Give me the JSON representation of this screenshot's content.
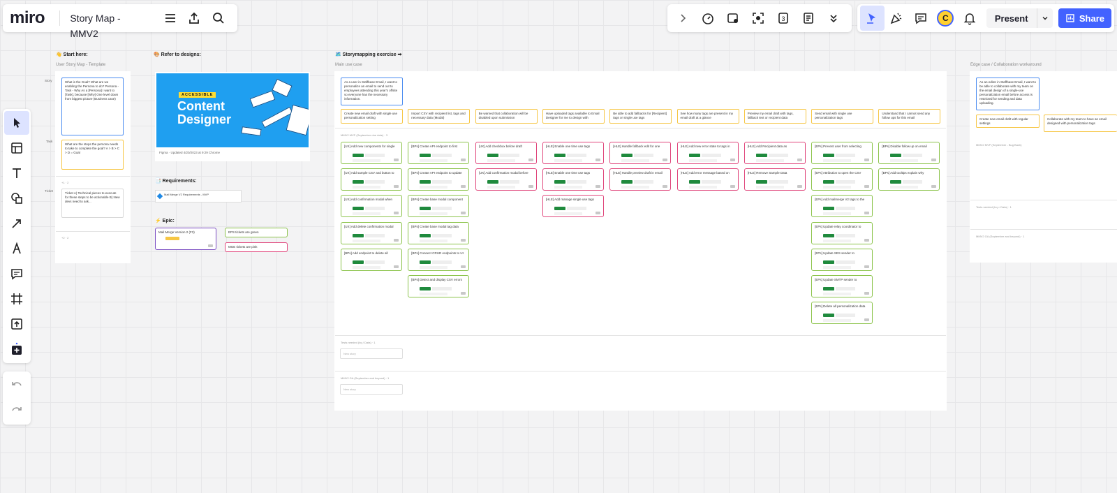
{
  "app": {
    "logo": "miro",
    "board_title": "Story Map - MMV2"
  },
  "toolbar_right": {
    "present_label": "Present",
    "share_label": "Share",
    "avatar_initial": "C",
    "colors": {
      "share_bg": "#4262ff",
      "active_tool_bg": "#dde3ff"
    }
  },
  "left_toolbar": {
    "tools": [
      "select",
      "templates",
      "text",
      "shapes",
      "connection-line",
      "pen",
      "comment",
      "frame",
      "upload",
      "more-apps"
    ]
  },
  "canvas": {
    "sections": {
      "start": {
        "title": "👋 Start here:",
        "label": "User Story Map - Template"
      },
      "designs": {
        "title": "🎨 Refer to designs:"
      },
      "storymap": {
        "title": "🗺️ Storymapping exercise ➡",
        "label": "Main use case"
      },
      "edge": {
        "label": "Edge case / Collaboration workaround"
      },
      "requirements": {
        "title": "📑 Requirements:",
        "item": "Mail Merge V2 Requirements - MVP"
      },
      "epic": {
        "title": "⚡ Epic:",
        "card": "Mail Merge Version 2 (F3)",
        "legend_green": "EPS tickets are green",
        "legend_pink": "MGE tickets are pink"
      }
    },
    "template_rows": {
      "story": "Story",
      "task": "Task",
      "ticket": "Ticket"
    },
    "template_stickies": {
      "goal": "What is the Goal? What are we enabling the Persona to do? Persona - Task - Why As a [Persona] I want to [Task], because [Why] One level down from biggest picture (Business case)",
      "steps": "What are the steps the persona needs to take to complete the goal? A > B > C > D = Goal",
      "ticket": "Ticket A) Technical pieces to execute for these steps to be actionable B) New devs need to ask..."
    },
    "design_image": {
      "badge": "ACCESSIBLE",
      "title": "Content Designer",
      "caption": "Figma · Updated 4/20/2023 at 9:29 Chrome"
    },
    "main": {
      "story": "As a user in Staffbase Email, I want to personalize an email to send out to employees attending this year's offsite so everyone has the necessary information.",
      "tasks": [
        "Create new email draft with single use personalization setting",
        "Import CSV with recipient list, tags and necessary data (Modal)",
        "Be warned that collaboration will be disabled upon submission",
        "Have uploaded tags available to Email Designer for me to design with",
        "Be able to add fallbacks for [Recipient] tags or single use tags",
        "See how many tags are present in my email draft at a glance",
        "Preview my email draft with tags, fallback text or recipient data",
        "Send email with single use personalization tags",
        "Understand that I cannot send any follow ups for this email"
      ],
      "release1_label": "MMV2 MVP (September due date) · 3",
      "columns": [
        [
          "[UX] Add new components for single",
          "[UX] Add sample CSV and button to",
          "[UX] Add confirmation modal when",
          "[UX] Add delete confirmation modal",
          "[BPs] Add endpoint to delete all"
        ],
        [
          "[BPs] Create API endpoint to first",
          "[BPs] Create API endpoint to update",
          "[BPs] Create base modal component",
          "[BPs] Create base modal tag data",
          "[BPs] Connect CRUD endpoints to UI",
          "[BPs] Detect and display CSV errors"
        ],
        [
          "[UX] Add checkbox before draft",
          "[UX] Add confirmation modal before"
        ],
        [
          "[HLE] Enable one time use tags",
          "[HLE] Enable one time use tags",
          "[HLE] Add manage single use tags"
        ],
        [
          "[HLE] Handle fallback edit for one",
          "[HLE] Handle preview draft in email"
        ],
        [
          "[HLE] Add new error state to tags in",
          "[HLE] Add error message based on"
        ],
        [
          "[HLE] Add Recipient data as",
          "[HLE] Remove Sample Data"
        ],
        [
          "[EPs] Prevent user from selecting",
          "[EPs] Attribution to open the CSV",
          "[EPs] Add mailmerge V2 tags to the",
          "[EPs] Update relay coordinator to",
          "[EPs] Update SES sender to",
          "[EPs] Update SMTP sender to",
          "[EPs] Delete all personalization data"
        ],
        [
          "[BPs] Disable follow up on email",
          "[BPs] Add tooltips explain why"
        ]
      ],
      "column_colors": [
        "green",
        "green",
        "pink",
        "pink",
        "pink",
        "pink",
        "pink",
        "green",
        "green"
      ],
      "release2_label": "Tests needed (bq / Data) · 1",
      "release3_label": "MMV2 GA (September and beyond) · 1",
      "new_story": "New story"
    },
    "edge": {
      "story": "As an editor in Staffbase Email, I want to be able to collaborate with my team on the email design of a single-use personalization email before access is restricted for sending and data uploading.",
      "task1": "Create new email draft with regular settings",
      "task2": "Collaborate with my team to have an email designed with personalization tags",
      "rel1": "MMV2 MVP (September - Bug Bash)",
      "rel2": "Tests needed (bq > Data) · 1",
      "rel3": "MMV2 GA (September and beyond) · 1"
    },
    "tiny_counts": {
      "t1": "+1 · 2",
      "t2": "+2 · 2"
    }
  }
}
